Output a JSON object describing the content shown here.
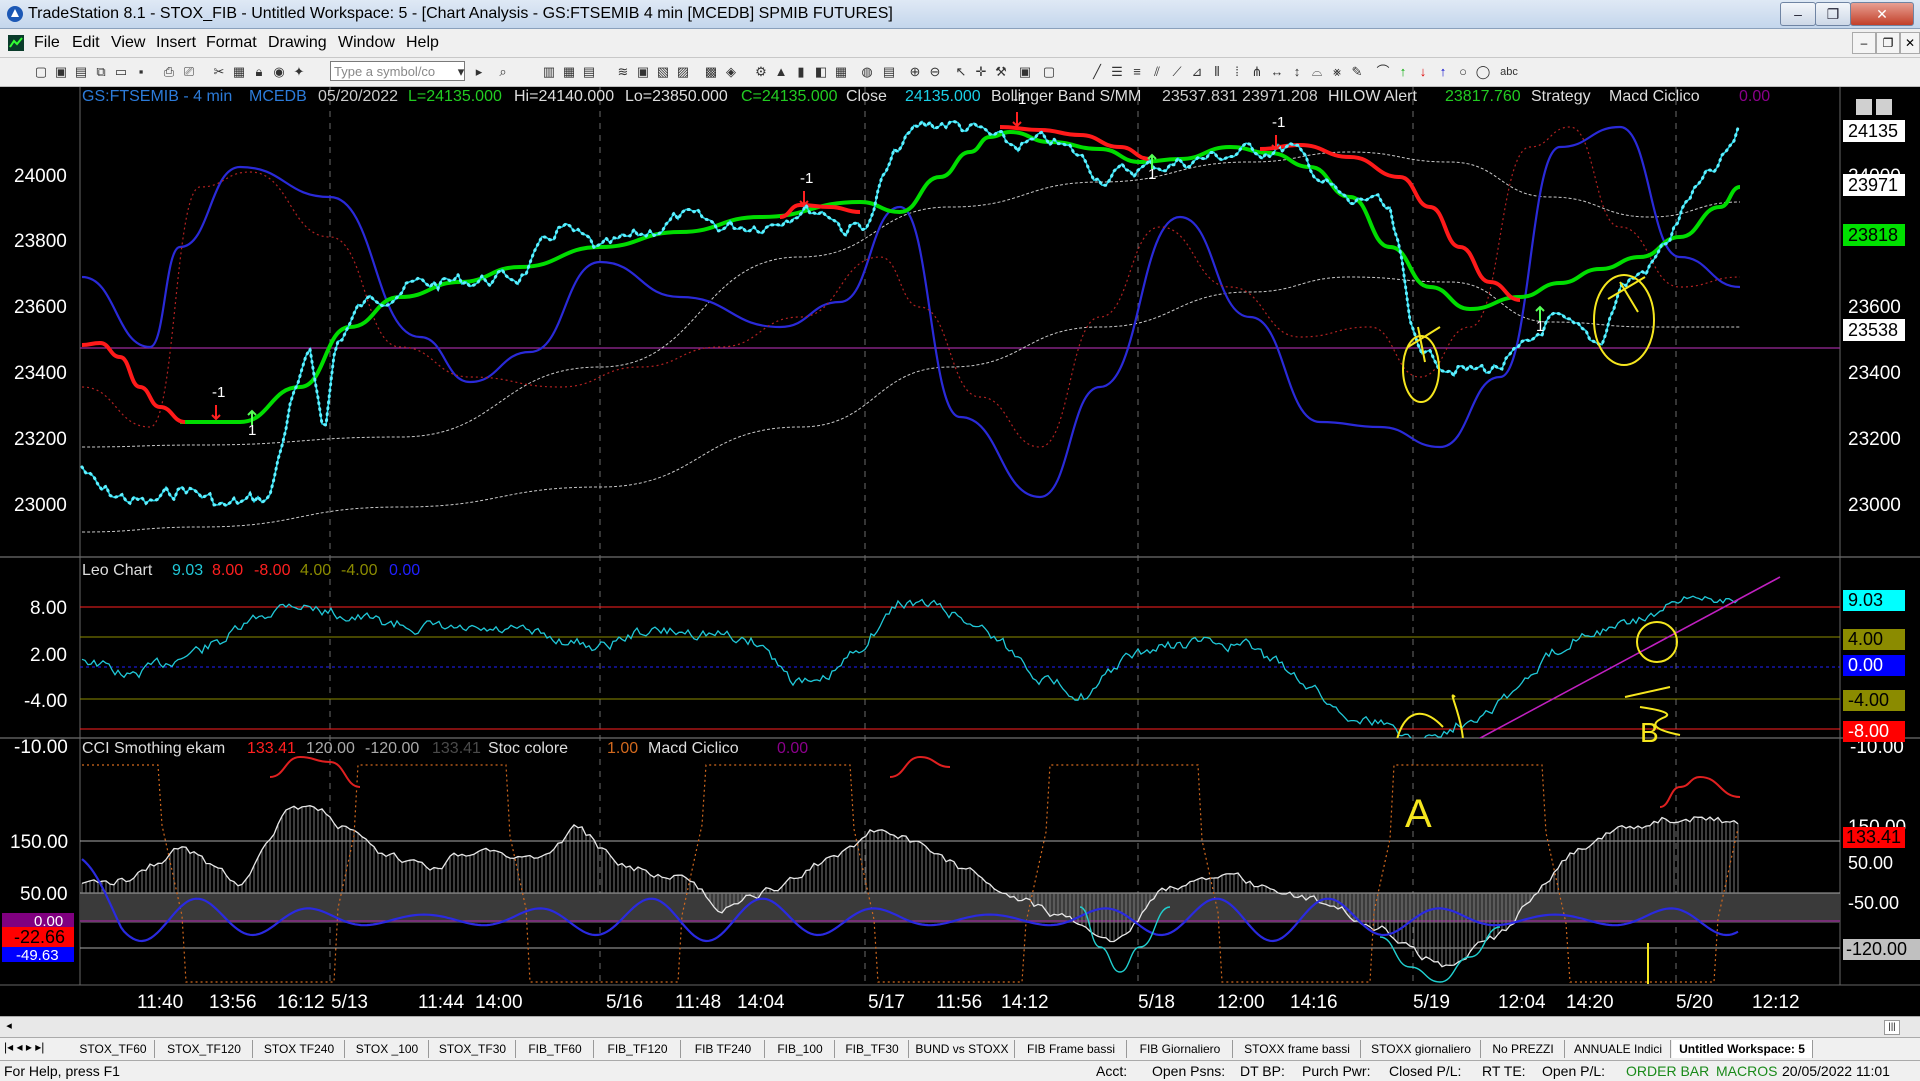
{
  "window": {
    "title": "TradeStation 8.1 - STOX_FIB - Untitled Workspace:  5 - [Chart Analysis - GS:FTSEMIB  4 min  [MCEDB] SPMIB FUTURES]"
  },
  "menu": [
    "File",
    "Edit",
    "View",
    "Insert",
    "Format",
    "Drawing",
    "Window",
    "Help"
  ],
  "toolbar": {
    "symbol_placeholder": "Type a symbol/co",
    "text_tool": "abc"
  },
  "chart": {
    "header": {
      "symbol": "GS:FTSEMIB - 4 min",
      "feed": "MCEDB",
      "date": "05/20/2022",
      "last": "L=24135.000",
      "hi": "Hi=24140.000",
      "lo": "Lo=23850.000",
      "close": "C=24135.000",
      "close_label": "Close",
      "close_val": "24135.000",
      "bb_label": "Bollinger Band S/MM",
      "bb_vals": "23537.831  23971.208",
      "hilow_label": "HILOW Alert",
      "hilow_val": "23817.760",
      "strategy": "Strategy",
      "macd": "Macd Ciclico",
      "macd_val": "0.00"
    },
    "price_axis": [
      "24000",
      "23800",
      "23600",
      "23400",
      "23200",
      "23000"
    ],
    "price_badges": [
      {
        "text": "24135",
        "bg": "#ffffff",
        "fg": "#000000"
      },
      {
        "text": "23971",
        "bg": "#ffffff",
        "fg": "#000000"
      },
      {
        "text": "23818",
        "bg": "#00e000",
        "fg": "#000000"
      },
      {
        "text": "23538",
        "bg": "#ffffff",
        "fg": "#000000"
      }
    ],
    "markers": [
      "-1",
      "-1",
      "1",
      "-1",
      "1",
      "-1",
      "1"
    ],
    "leo": {
      "title": "Leo Chart",
      "v1": "9.03",
      "v2": "8.00",
      "v3": "-8.00",
      "v4": "4.00",
      "v5": "-4.00",
      "v6": "0.00",
      "axis": [
        "8.00",
        "2.00",
        "-4.00",
        "-10.00"
      ],
      "badges": [
        {
          "text": "9.03",
          "bg": "#00ffff",
          "fg": "#000000"
        },
        {
          "text": "4.00",
          "bg": "#8b8b00",
          "fg": "#000000"
        },
        {
          "text": "0.00",
          "bg": "#0000ff",
          "fg": "#ffffff"
        },
        {
          "text": "-4.00",
          "bg": "#8b8b00",
          "fg": "#000000"
        },
        {
          "text": "-8.00",
          "bg": "#ff0000",
          "fg": "#ffffff"
        }
      ]
    },
    "cci": {
      "title": "CCI Smothing ekam",
      "v1": "133.41",
      "v2": "120.00",
      "v3": "-120.00",
      "v4": "133.41",
      "stoc": "Stoc colore",
      "stoc_val": "1.00",
      "macd": "Macd Ciclico",
      "macd_val": "0.00",
      "axis": [
        "150.00",
        "50.00"
      ],
      "right_badges": [
        {
          "text": "133.41",
          "bg": "#ff0000",
          "fg": "#000000"
        },
        {
          "text": "50.00",
          "bg": "#000000",
          "fg": "#ffffff"
        },
        {
          "text": "-50.00",
          "bg": "#000000",
          "fg": "#ffffff"
        },
        {
          "text": "-120.00",
          "bg": "#c0c0c0",
          "fg": "#000000"
        }
      ],
      "left_badges": [
        {
          "text": "0.00",
          "bg": "#800080",
          "fg": "#ffffff"
        },
        {
          "text": "-22.66",
          "bg": "#ff0000",
          "fg": "#000000"
        },
        {
          "text": "-49.63",
          "bg": "#0000ff",
          "fg": "#ffffff"
        }
      ]
    },
    "time_axis": [
      "11:40",
      "13:56",
      "16:12",
      "5/13",
      "11:44",
      "14:00",
      "5/16",
      "11:48",
      "14:04",
      "5/17",
      "11:56",
      "14:12",
      "5/18",
      "12:00",
      "14:16",
      "5/19",
      "12:04",
      "14:20",
      "5/20",
      "12:12"
    ],
    "annotations": [
      "A",
      "B"
    ]
  },
  "tabs": [
    "STOX_TF60",
    "STOX_TF120",
    "STOX TF240",
    "STOX _100",
    "STOX_TF30",
    "FIB_TF60",
    "FIB_TF120",
    "FIB TF240",
    "FIB_100",
    "FIB_TF30",
    "BUND vs STOXX",
    "FIB Frame bassi",
    "FIB Giornaliero",
    "STOXX frame bassi",
    "STOXX giornaliero",
    "No PREZZI",
    "ANNUALE Indici",
    "Untitled Workspace:  5"
  ],
  "status": {
    "help": "For Help, press F1",
    "acct": "Acct:",
    "open_psns": "Open Psns:",
    "dt_bp": "DT BP:",
    "purch_pwr": "Purch Pwr:",
    "closed_pl": "Closed P/L:",
    "rt_te": "RT TE:",
    "open_pl": "Open P/L:",
    "order_bar": "ORDER BAR",
    "macros": "MACROS",
    "datetime": "20/05/2022 11:01"
  }
}
